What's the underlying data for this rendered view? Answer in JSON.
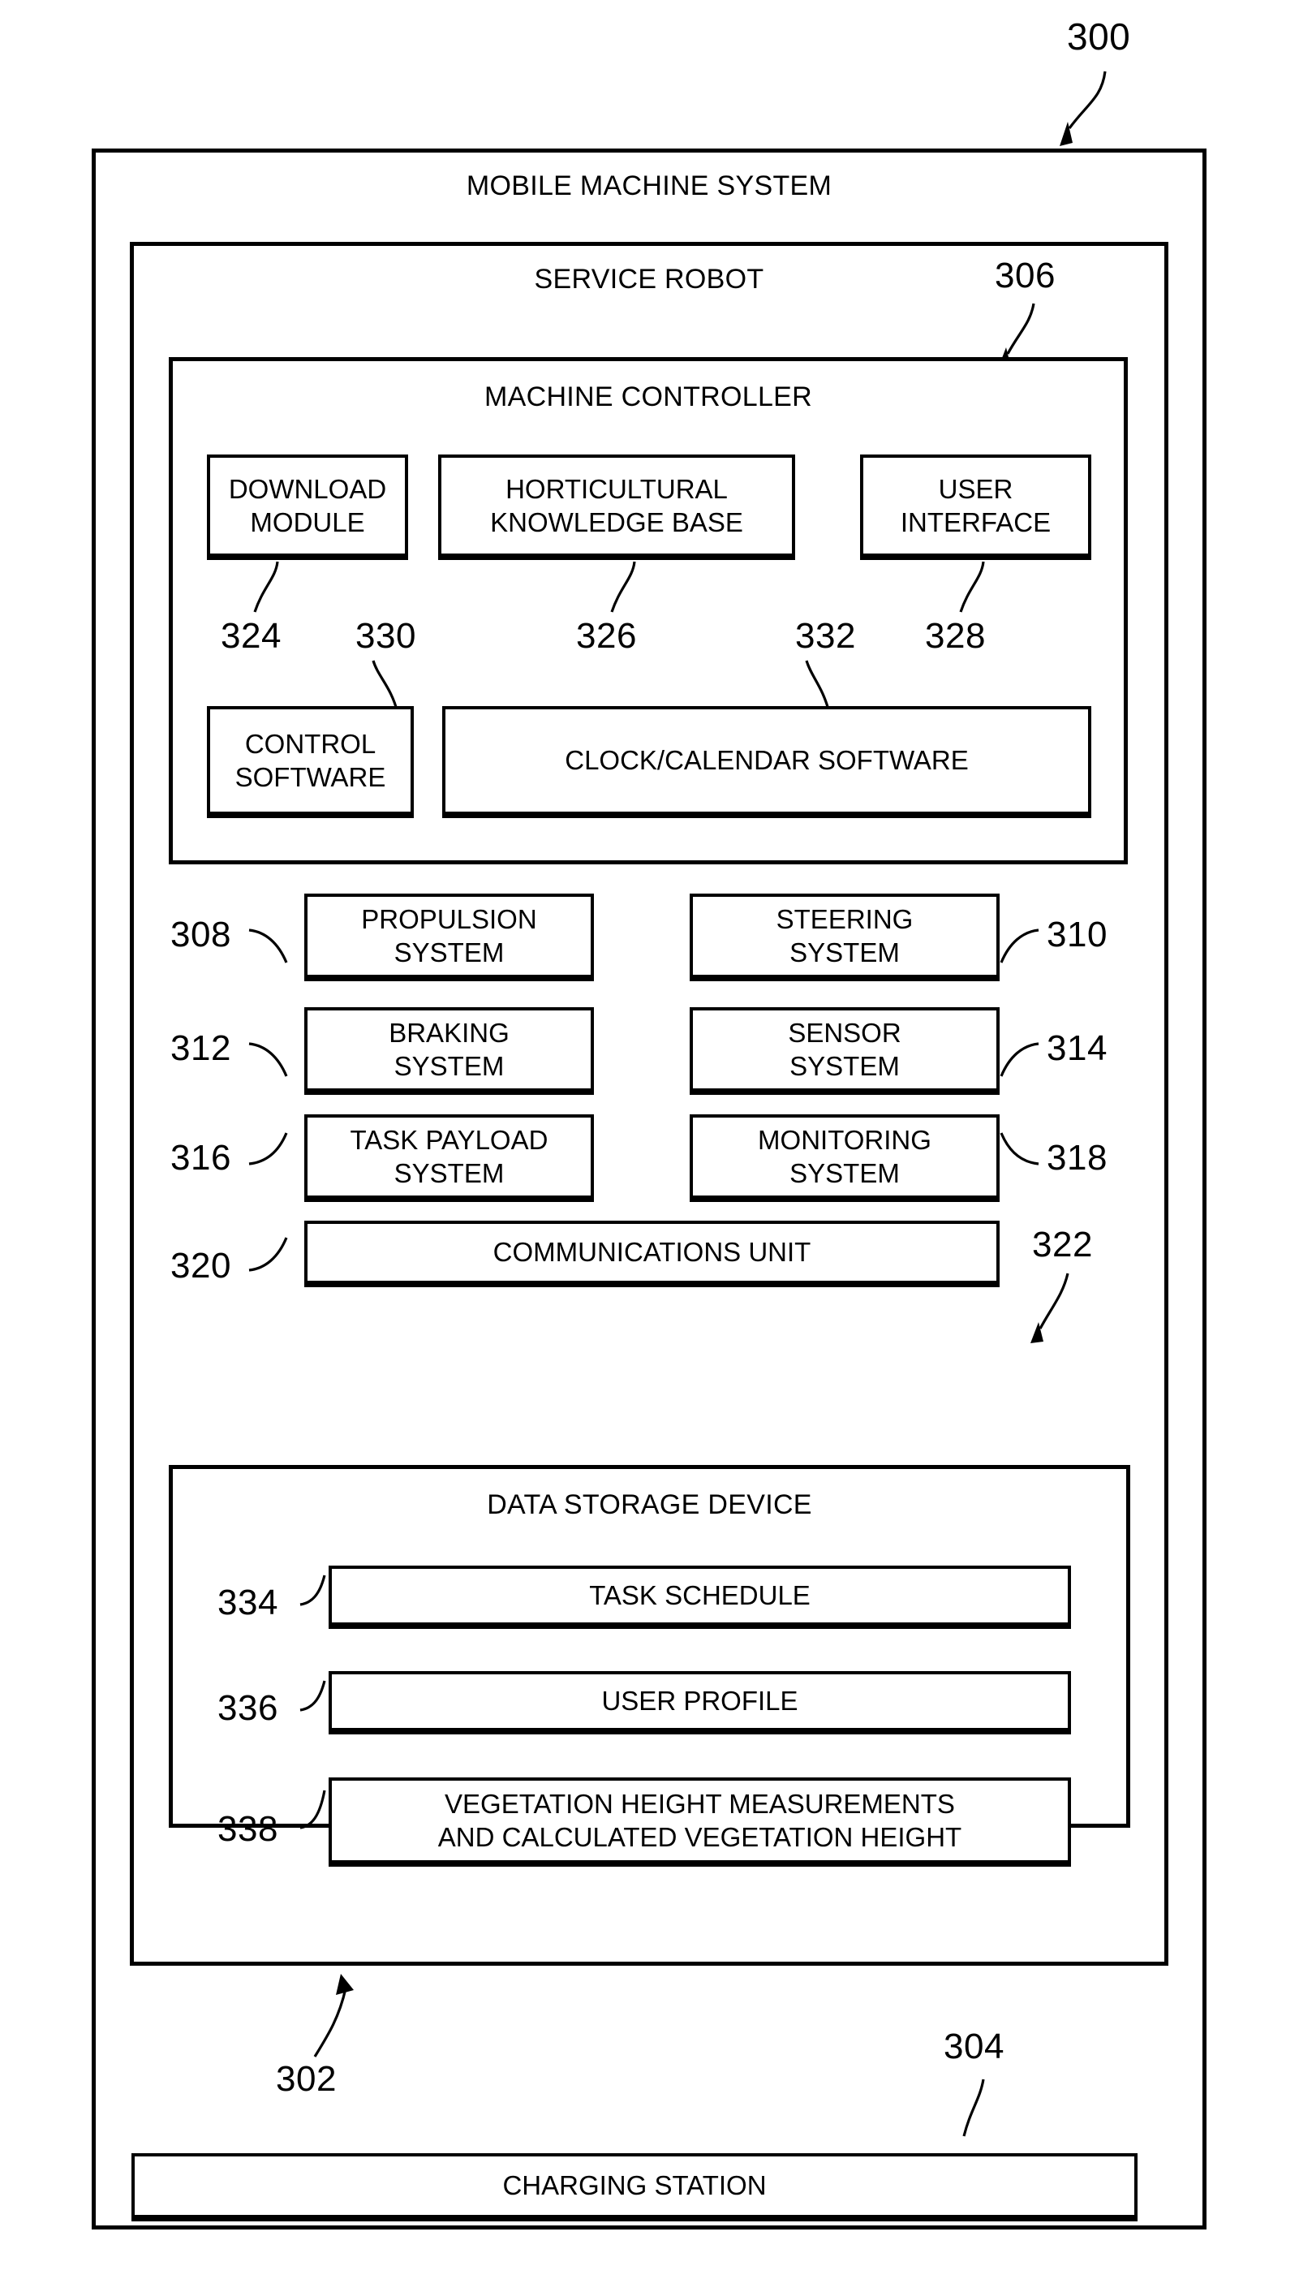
{
  "figure": {
    "top_ref": "300",
    "outer_box_title": "MOBILE MACHINE SYSTEM",
    "service_robot_title": "SERVICE ROBOT",
    "service_robot_ref": "302",
    "machine_controller_title": "MACHINE CONTROLLER",
    "machine_controller_ref": "306",
    "charging_station_label": "CHARGING STATION",
    "charging_station_ref": "304"
  },
  "machine_controller": {
    "modules": [
      {
        "label": "DOWNLOAD\nMODULE",
        "ref": "324"
      },
      {
        "label": "HORTICULTURAL\nKNOWLEDGE BASE",
        "ref": "326"
      },
      {
        "label": "USER\nINTERFACE",
        "ref": "328"
      },
      {
        "label": "CONTROL\nSOFTWARE",
        "ref": "330"
      },
      {
        "label": "CLOCK/CALENDAR SOFTWARE",
        "ref": "332"
      }
    ]
  },
  "systems": [
    {
      "label": "PROPULSION\nSYSTEM",
      "ref": "308",
      "ref_side": "left"
    },
    {
      "label": "STEERING\nSYSTEM",
      "ref": "310",
      "ref_side": "right"
    },
    {
      "label": "BRAKING\nSYSTEM",
      "ref": "312",
      "ref_side": "left"
    },
    {
      "label": "SENSOR\nSYSTEM",
      "ref": "314",
      "ref_side": "right"
    },
    {
      "label": "TASK PAYLOAD\nSYSTEM",
      "ref": "316",
      "ref_side": "left"
    },
    {
      "label": "MONITORING\nSYSTEM",
      "ref": "318",
      "ref_side": "right"
    },
    {
      "label": "COMMUNICATIONS UNIT",
      "ref": "320",
      "ref_side": "left"
    }
  ],
  "data_storage": {
    "title": "DATA STORAGE DEVICE",
    "ref": "322",
    "items": [
      {
        "label": "TASK SCHEDULE",
        "ref": "334"
      },
      {
        "label": "USER PROFILE",
        "ref": "336"
      },
      {
        "label": "VEGETATION HEIGHT MEASUREMENTS\nAND CALCULATED VEGETATION HEIGHT",
        "ref": "338"
      }
    ]
  }
}
